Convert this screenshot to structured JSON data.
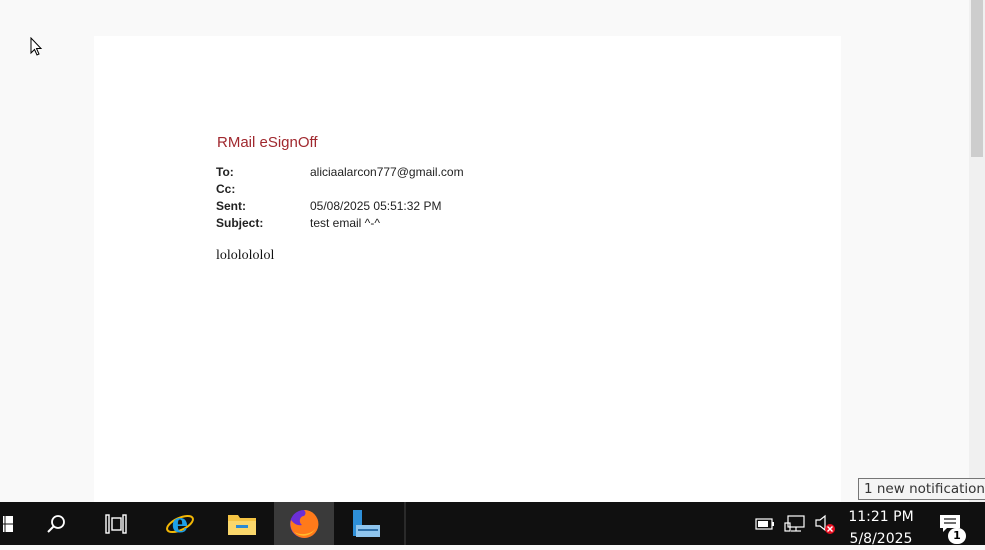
{
  "document": {
    "title": "RMail eSignOff",
    "headers": [
      {
        "key": "To:",
        "value": "aliciaalarcon777@gmail.com"
      },
      {
        "key": "Cc:",
        "value": ""
      },
      {
        "key": "Sent:",
        "value": "05/08/2025 05:51:32 PM"
      },
      {
        "key": "Subject:",
        "value": "test email ^-^"
      }
    ],
    "body": "lololololol",
    "title_color": "#a0282e"
  },
  "taskbar": {
    "apps": [
      {
        "name": "start",
        "icon": "windows-logo-icon"
      },
      {
        "name": "search",
        "icon": "search-icon"
      },
      {
        "name": "task-view",
        "icon": "task-view-icon"
      },
      {
        "name": "internet-explorer",
        "icon": "internet-explorer-icon"
      },
      {
        "name": "file-explorer",
        "icon": "folder-icon"
      },
      {
        "name": "firefox",
        "icon": "firefox-icon",
        "active": true
      },
      {
        "name": "server-manager",
        "icon": "server-manager-icon"
      }
    ],
    "clock": {
      "time": "11:21 PM",
      "date": "5/8/2025"
    },
    "tray": [
      "battery-icon",
      "network-icon",
      "volume-muted-icon"
    ],
    "notifications": {
      "count": "1",
      "toast": "1 new notification"
    }
  }
}
